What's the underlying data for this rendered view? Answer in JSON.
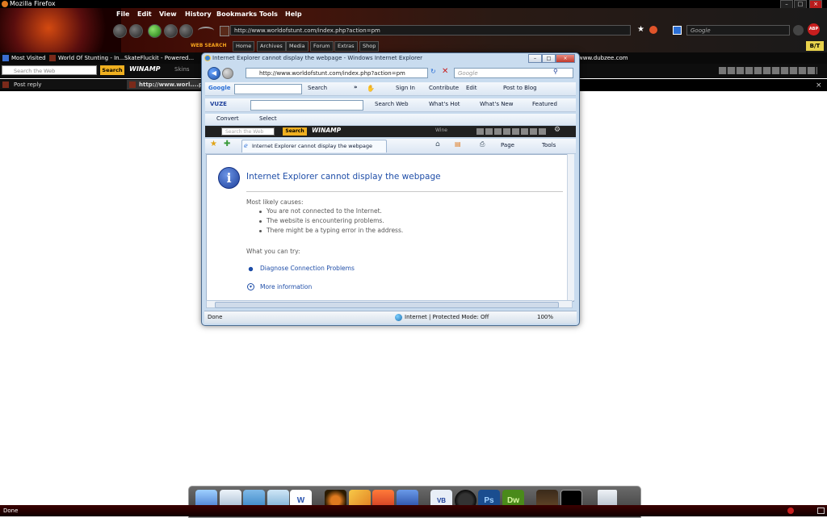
{
  "firefox": {
    "title": "Mozilla Firefox",
    "menu": [
      "File",
      "Edit",
      "View",
      "History",
      "Bookmarks",
      "Tools",
      "Help"
    ],
    "url": "http://www.worldofstunt.com/index.php?action=pm",
    "search_placeholder": "Google",
    "websearch_label": "WEB SEARCH",
    "site_tabs": [
      "Home",
      "Archives",
      "Media",
      "Forum",
      "Extras",
      "Shop"
    ],
    "bt_label": "B/T",
    "abp_label": "ABP",
    "bookmarks": [
      "Most Visited",
      "World Of Stunting - In...",
      "SkateFluckit - Powered...",
      "www.dubzee.com"
    ],
    "toolbar_search_placeholder": "Search the Web",
    "toolbar_search_btn": "Search",
    "winamp_label": "WINAMP",
    "skins_label": "Skins",
    "tabs": [
      "Post reply",
      "http://www.worl....php"
    ],
    "status": "Done"
  },
  "ie": {
    "title": "Internet Explorer cannot display the webpage - Windows Internet Explorer",
    "url": "http://www.worldofstunt.com/index.php?action=pm",
    "search_placeholder": "Google",
    "google_toolbar": {
      "brand": "Google",
      "search": "Search",
      "more": "»",
      "sign_in": "Sign In",
      "contribute": "Contribute",
      "edit": "Edit",
      "post_to_blog": "Post to Blog"
    },
    "vuze_toolbar": {
      "brand": "VUZE",
      "search_web": "Search Web",
      "whats_hot": "What's Hot",
      "whats_new": "What's New",
      "featured": "Featured"
    },
    "convert_toolbar": {
      "convert": "Convert",
      "select": "Select"
    },
    "winamp_toolbar": {
      "placeholder": "Search the Web",
      "search_btn": "Search",
      "winamp": "WINAMP",
      "wine": "Wine"
    },
    "tab_label": "Internet Explorer cannot display the webpage",
    "cmd": {
      "page": "Page",
      "tools": "Tools"
    },
    "content": {
      "heading": "Internet Explorer cannot display the webpage",
      "causes_title": "Most likely causes:",
      "causes": [
        "You are not connected to the Internet.",
        "The website is encountering problems.",
        "There might be a typing error in the address."
      ],
      "try_title": "What you can try:",
      "diagnose_link": "Diagnose Connection Problems",
      "more_info_link": "More information"
    },
    "status": {
      "left": "Done",
      "zone": "Internet | Protected Mode: Off",
      "zoom": "100%"
    }
  },
  "dock": {
    "icons": [
      "finder-icon",
      "mail-icon",
      "folder-icon",
      "notes-icon",
      "word-icon",
      "cat-icon",
      "pencil-icon",
      "box-icon",
      "paw-icon",
      "vb-icon",
      "monitor-icon",
      "ps-icon",
      "dw-icon",
      "poker-icon",
      "steam-icon",
      "trash-icon"
    ],
    "labels": {
      "ps": "Ps",
      "dw": "Dw",
      "vb": "VB",
      "word": "W"
    }
  },
  "colors": {
    "ie_link": "#1f4ea8",
    "ff_accent": "#f7a41d",
    "dock": "#4a4a4a"
  }
}
